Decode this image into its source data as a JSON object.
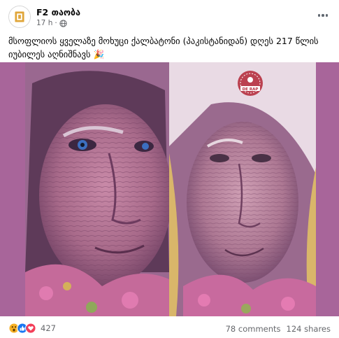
{
  "post": {
    "page_name": "F2 თაობა",
    "time": "17 h",
    "separator": "·",
    "text": "მსოფლიოს ყველაზე მოხუცი ქალბატონი (პაკისტანიდან)  დღეს 217 წლის იუბილეს აღნიშნავს 🎉",
    "watermark_text": "DE RAP"
  },
  "icons": {
    "avatar": "f2-logo",
    "privacy": "globe-icon",
    "more": "more-options-icon",
    "reactions": [
      "wow-reaction-icon",
      "like-reaction-icon",
      "love-reaction-icon"
    ]
  },
  "footer": {
    "reaction_count": "427",
    "comments": "78 comments",
    "shares": "124 shares"
  },
  "colors": {
    "media_background": "#a8659a",
    "like_blue": "#1877f2",
    "love_red": "#f33e58",
    "wow_yellow": "#f7b125",
    "secondary_text": "#65676b"
  }
}
